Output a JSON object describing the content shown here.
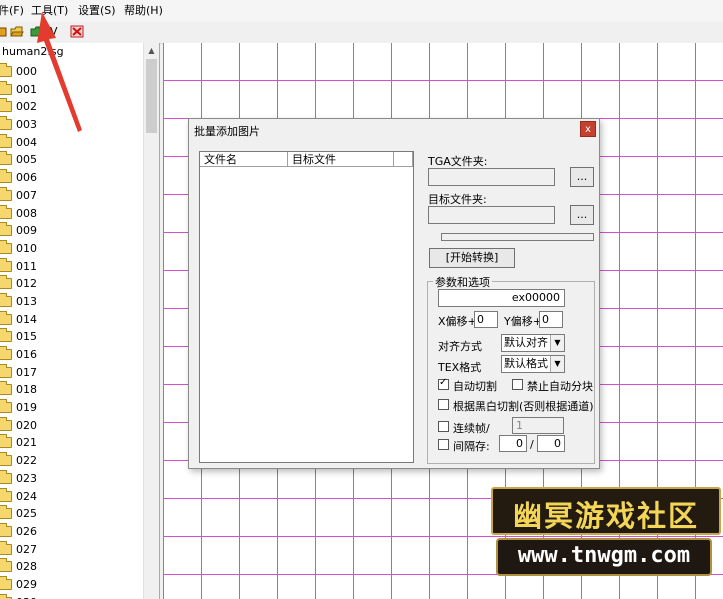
{
  "menubar": {
    "items": [
      "件(F)",
      "工具(T)",
      "设置(S)",
      "帮助(H)"
    ]
  },
  "toolbar": {
    "icons": [
      "new-icon",
      "open-icon",
      "save-icon",
      "import-icon",
      "delete-icon"
    ],
    "glyph_v": "V"
  },
  "tree": {
    "root": "human2.sg",
    "items": [
      "000",
      "001",
      "002",
      "003",
      "004",
      "005",
      "006",
      "007",
      "008",
      "009",
      "010",
      "011",
      "012",
      "013",
      "014",
      "015",
      "016",
      "017",
      "018",
      "019",
      "020",
      "021",
      "022",
      "023",
      "024",
      "025",
      "026",
      "027",
      "028",
      "029",
      "030"
    ]
  },
  "dialog": {
    "title": "批量添加图片",
    "close": "x",
    "list_columns": [
      "文件名",
      "目标文件"
    ],
    "tga_label": "TGA文件夹:",
    "target_label": "目标文件夹:",
    "browse": "...",
    "start_button": "[开始转换]",
    "options_group": "参数和选项",
    "prefix_value": "ex00000",
    "x_offset_label": "X偏移+",
    "x_offset_value": "0",
    "y_offset_label": "Y偏移+",
    "y_offset_value": "0",
    "align_label": "对齐方式",
    "align_value": "默认对齐",
    "tex_label": "TEX格式",
    "tex_value": "默认格式",
    "auto_cut_label": "自动切割",
    "auto_cut_checked": true,
    "no_auto_block_label": "禁止自动分块",
    "no_auto_block_checked": false,
    "bw_cut_label": "根据黑白切割(否则根据通道)",
    "bw_cut_checked": false,
    "frames_label": "连续帧/",
    "frames_value": "1",
    "frames_checked": false,
    "interval_label": "间隔存:",
    "interval_value1": "0",
    "interval_sep": "/",
    "interval_value2": "0",
    "interval_checked": false
  },
  "watermark": {
    "title": "幽冥游戏社区",
    "url": "www.tnwgm.com"
  },
  "colors": {
    "grid": "#d24fd2",
    "close_button": "#c4402f",
    "arrow": "#e33b2e",
    "folder": "#f5d76e"
  }
}
